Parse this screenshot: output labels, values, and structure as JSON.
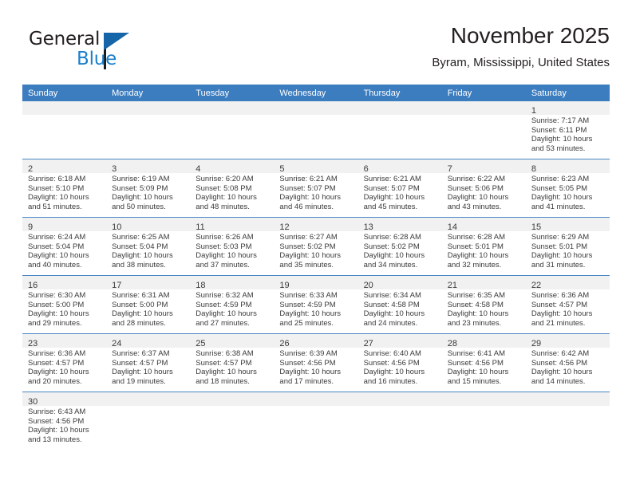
{
  "brand": {
    "name_part1": "General",
    "name_part2": "Blue",
    "logo_icon": "triangle-flag-icon"
  },
  "header": {
    "month_title": "November 2025",
    "location": "Byram, Mississippi, United States"
  },
  "theme": {
    "header_blue": "#3c7dc0",
    "row_divider_blue": "#4a86c5",
    "daynum_band": "#f1f1f1",
    "brand_blue": "#1b7fcc",
    "text": "#3a3a3a"
  },
  "calendar": {
    "weekday_headers": [
      "Sunday",
      "Monday",
      "Tuesday",
      "Wednesday",
      "Thursday",
      "Friday",
      "Saturday"
    ],
    "weeks": [
      [
        {
          "empty": true
        },
        {
          "empty": true
        },
        {
          "empty": true
        },
        {
          "empty": true
        },
        {
          "empty": true
        },
        {
          "empty": true
        },
        {
          "day": "1",
          "lines": [
            "Sunrise: 7:17 AM",
            "Sunset: 6:11 PM",
            "Daylight: 10 hours",
            "and 53 minutes."
          ]
        }
      ],
      [
        {
          "day": "2",
          "lines": [
            "Sunrise: 6:18 AM",
            "Sunset: 5:10 PM",
            "Daylight: 10 hours",
            "and 51 minutes."
          ]
        },
        {
          "day": "3",
          "lines": [
            "Sunrise: 6:19 AM",
            "Sunset: 5:09 PM",
            "Daylight: 10 hours",
            "and 50 minutes."
          ]
        },
        {
          "day": "4",
          "lines": [
            "Sunrise: 6:20 AM",
            "Sunset: 5:08 PM",
            "Daylight: 10 hours",
            "and 48 minutes."
          ]
        },
        {
          "day": "5",
          "lines": [
            "Sunrise: 6:21 AM",
            "Sunset: 5:07 PM",
            "Daylight: 10 hours",
            "and 46 minutes."
          ]
        },
        {
          "day": "6",
          "lines": [
            "Sunrise: 6:21 AM",
            "Sunset: 5:07 PM",
            "Daylight: 10 hours",
            "and 45 minutes."
          ]
        },
        {
          "day": "7",
          "lines": [
            "Sunrise: 6:22 AM",
            "Sunset: 5:06 PM",
            "Daylight: 10 hours",
            "and 43 minutes."
          ]
        },
        {
          "day": "8",
          "lines": [
            "Sunrise: 6:23 AM",
            "Sunset: 5:05 PM",
            "Daylight: 10 hours",
            "and 41 minutes."
          ]
        }
      ],
      [
        {
          "day": "9",
          "lines": [
            "Sunrise: 6:24 AM",
            "Sunset: 5:04 PM",
            "Daylight: 10 hours",
            "and 40 minutes."
          ]
        },
        {
          "day": "10",
          "lines": [
            "Sunrise: 6:25 AM",
            "Sunset: 5:04 PM",
            "Daylight: 10 hours",
            "and 38 minutes."
          ]
        },
        {
          "day": "11",
          "lines": [
            "Sunrise: 6:26 AM",
            "Sunset: 5:03 PM",
            "Daylight: 10 hours",
            "and 37 minutes."
          ]
        },
        {
          "day": "12",
          "lines": [
            "Sunrise: 6:27 AM",
            "Sunset: 5:02 PM",
            "Daylight: 10 hours",
            "and 35 minutes."
          ]
        },
        {
          "day": "13",
          "lines": [
            "Sunrise: 6:28 AM",
            "Sunset: 5:02 PM",
            "Daylight: 10 hours",
            "and 34 minutes."
          ]
        },
        {
          "day": "14",
          "lines": [
            "Sunrise: 6:28 AM",
            "Sunset: 5:01 PM",
            "Daylight: 10 hours",
            "and 32 minutes."
          ]
        },
        {
          "day": "15",
          "lines": [
            "Sunrise: 6:29 AM",
            "Sunset: 5:01 PM",
            "Daylight: 10 hours",
            "and 31 minutes."
          ]
        }
      ],
      [
        {
          "day": "16",
          "lines": [
            "Sunrise: 6:30 AM",
            "Sunset: 5:00 PM",
            "Daylight: 10 hours",
            "and 29 minutes."
          ]
        },
        {
          "day": "17",
          "lines": [
            "Sunrise: 6:31 AM",
            "Sunset: 5:00 PM",
            "Daylight: 10 hours",
            "and 28 minutes."
          ]
        },
        {
          "day": "18",
          "lines": [
            "Sunrise: 6:32 AM",
            "Sunset: 4:59 PM",
            "Daylight: 10 hours",
            "and 27 minutes."
          ]
        },
        {
          "day": "19",
          "lines": [
            "Sunrise: 6:33 AM",
            "Sunset: 4:59 PM",
            "Daylight: 10 hours",
            "and 25 minutes."
          ]
        },
        {
          "day": "20",
          "lines": [
            "Sunrise: 6:34 AM",
            "Sunset: 4:58 PM",
            "Daylight: 10 hours",
            "and 24 minutes."
          ]
        },
        {
          "day": "21",
          "lines": [
            "Sunrise: 6:35 AM",
            "Sunset: 4:58 PM",
            "Daylight: 10 hours",
            "and 23 minutes."
          ]
        },
        {
          "day": "22",
          "lines": [
            "Sunrise: 6:36 AM",
            "Sunset: 4:57 PM",
            "Daylight: 10 hours",
            "and 21 minutes."
          ]
        }
      ],
      [
        {
          "day": "23",
          "lines": [
            "Sunrise: 6:36 AM",
            "Sunset: 4:57 PM",
            "Daylight: 10 hours",
            "and 20 minutes."
          ]
        },
        {
          "day": "24",
          "lines": [
            "Sunrise: 6:37 AM",
            "Sunset: 4:57 PM",
            "Daylight: 10 hours",
            "and 19 minutes."
          ]
        },
        {
          "day": "25",
          "lines": [
            "Sunrise: 6:38 AM",
            "Sunset: 4:57 PM",
            "Daylight: 10 hours",
            "and 18 minutes."
          ]
        },
        {
          "day": "26",
          "lines": [
            "Sunrise: 6:39 AM",
            "Sunset: 4:56 PM",
            "Daylight: 10 hours",
            "and 17 minutes."
          ]
        },
        {
          "day": "27",
          "lines": [
            "Sunrise: 6:40 AM",
            "Sunset: 4:56 PM",
            "Daylight: 10 hours",
            "and 16 minutes."
          ]
        },
        {
          "day": "28",
          "lines": [
            "Sunrise: 6:41 AM",
            "Sunset: 4:56 PM",
            "Daylight: 10 hours",
            "and 15 minutes."
          ]
        },
        {
          "day": "29",
          "lines": [
            "Sunrise: 6:42 AM",
            "Sunset: 4:56 PM",
            "Daylight: 10 hours",
            "and 14 minutes."
          ]
        }
      ],
      [
        {
          "day": "30",
          "lines": [
            "Sunrise: 6:43 AM",
            "Sunset: 4:56 PM",
            "Daylight: 10 hours",
            "and 13 minutes."
          ]
        },
        {
          "empty": true
        },
        {
          "empty": true
        },
        {
          "empty": true
        },
        {
          "empty": true
        },
        {
          "empty": true
        },
        {
          "empty": true
        }
      ]
    ]
  }
}
